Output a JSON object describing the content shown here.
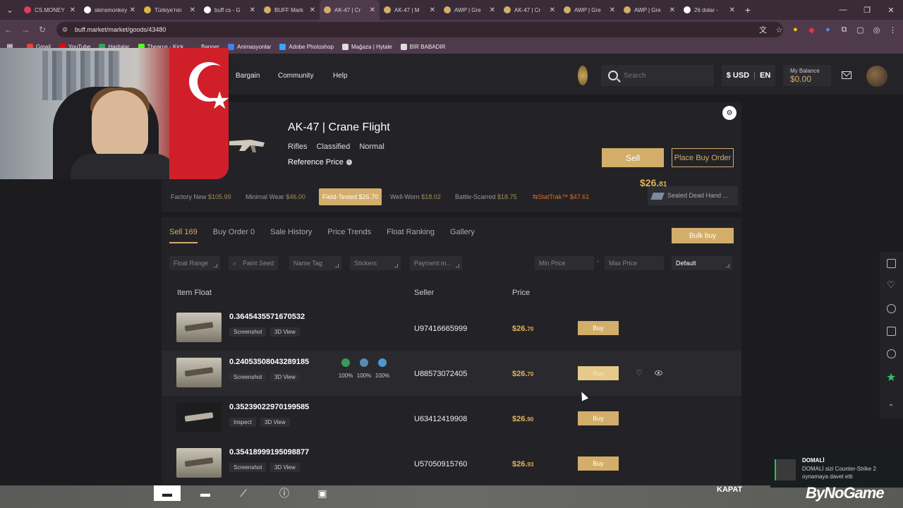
{
  "browser": {
    "tabs": [
      {
        "title": "CS.MONEY",
        "color": "#e23b5c"
      },
      {
        "title": "skinsmonkey",
        "color": "#ffffff"
      },
      {
        "title": "Türkiye'nin",
        "color": "#e3b341"
      },
      {
        "title": "buff cs - G",
        "color": "#ffffff"
      },
      {
        "title": "BUFF Mark",
        "color": "#d3ad6a"
      },
      {
        "title": "AK-47 | Cr",
        "color": "#d3ad6a"
      },
      {
        "title": "AK-47 | M",
        "color": "#d3ad6a"
      },
      {
        "title": "AWP | Gre",
        "color": "#d3ad6a"
      },
      {
        "title": "AK-47 | Cr",
        "color": "#d3ad6a"
      },
      {
        "title": "AWP | Gre",
        "color": "#d3ad6a"
      },
      {
        "title": "AWP | Gre",
        "color": "#d3ad6a"
      },
      {
        "title": "26 dolar -",
        "color": "#ffffff"
      }
    ],
    "url": "buff.market/market/goods/43480",
    "bookmarks": [
      {
        "label": "Gmail",
        "color": "#ea4335"
      },
      {
        "label": "YouTube",
        "color": "#ff0000"
      },
      {
        "label": "Haritalar",
        "color": "#34a853"
      },
      {
        "label": "Thearus - Kick",
        "color": "#53fc18"
      },
      {
        "label": "Banner",
        "color": "#444444"
      },
      {
        "label": "Animasyonlar",
        "color": "#3b82f6"
      },
      {
        "label": "Adobe Photoshop",
        "color": "#31a8ff"
      },
      {
        "label": "Mağaza | Hytale",
        "color": "#dddddd"
      },
      {
        "label": "BİR BABADIR",
        "color": "#dddddd"
      }
    ]
  },
  "header": {
    "nav": [
      "Bargain",
      "Community",
      "Help"
    ],
    "search_placeholder": "Search",
    "currency": "$ USD",
    "language": "EN",
    "balance_label": "My Balance",
    "balance_value": "$0.00"
  },
  "item": {
    "title": "AK-47 | Crane Flight",
    "tags": [
      "Rifles",
      "Classified",
      "Normal"
    ],
    "ref_label": "Reference Price",
    "ref_price_main": "$26.",
    "ref_price_cents": "81",
    "sell_label": "Sell",
    "buy_order_label": "Place Buy Order",
    "wears": [
      {
        "name": "Factory New",
        "price": "$105.99",
        "active": false
      },
      {
        "name": "Minimal Wear",
        "price": "$46.00",
        "active": false
      },
      {
        "name": "Field-Tested",
        "price": "$26.70",
        "active": true
      },
      {
        "name": "Well-Worn",
        "price": "$18.02",
        "active": false
      },
      {
        "name": "Battle-Scarred",
        "price": "$18.75",
        "active": false
      },
      {
        "name": "StatTrak™",
        "price": "$47.61",
        "active": false
      }
    ],
    "sealed": "Sealed Dead Hand ..."
  },
  "listing": {
    "tabs": [
      "Sell 169",
      "Buy Order 0",
      "Sale History",
      "Price Trends",
      "Float Ranking",
      "Gallery"
    ],
    "bulk_buy": "Bulk buy",
    "filters": {
      "float_range": "Float Range",
      "paint_seed": "Paint Seed",
      "name_tag": "Name Tag",
      "stickers": "Stickers",
      "payment": "Payment m...",
      "min_price": "Min Price",
      "dash": "-",
      "max_price": "Max Price",
      "sort": "Default"
    },
    "columns": {
      "float": "Item Float",
      "seller": "Seller",
      "price": "Price"
    },
    "rows": [
      {
        "float": "0.3645435571670532",
        "btn1": "Screenshot",
        "btn2": "3D View",
        "seller": "U97416665999",
        "price_main": "$26.",
        "price_cents": "70",
        "buy": "Buy"
      },
      {
        "float": "0.24053508043289185",
        "btn1": "Screenshot",
        "btn2": "3D View",
        "seller": "U88573072405",
        "price_main": "$26.",
        "price_cents": "70",
        "buy": "Buy",
        "stickers": [
          {
            "pct": "100%",
            "color": "#3a9a5a"
          },
          {
            "pct": "100%",
            "color": "#5a8ab0"
          },
          {
            "pct": "100%",
            "color": "#4a9ad0"
          }
        ]
      },
      {
        "float": "0.35239022970199585",
        "btn1": "Inspect",
        "btn2": "3D View",
        "seller": "U63412419908",
        "price_main": "$26.",
        "price_cents": "90",
        "buy": "Buy"
      },
      {
        "float": "0.35418999195098877",
        "btn1": "Screenshot",
        "btn2": "3D View",
        "seller": "U57050915760",
        "price_main": "$26.",
        "price_cents": "93",
        "buy": "Buy"
      }
    ]
  },
  "overlay": {
    "kapat": "KAPAT",
    "notif_name": "DOMALİ",
    "notif_msg": "DOMALİ sizi Counter-Strike 2 oynamaya davet etti",
    "logo": "ByNoGame"
  }
}
